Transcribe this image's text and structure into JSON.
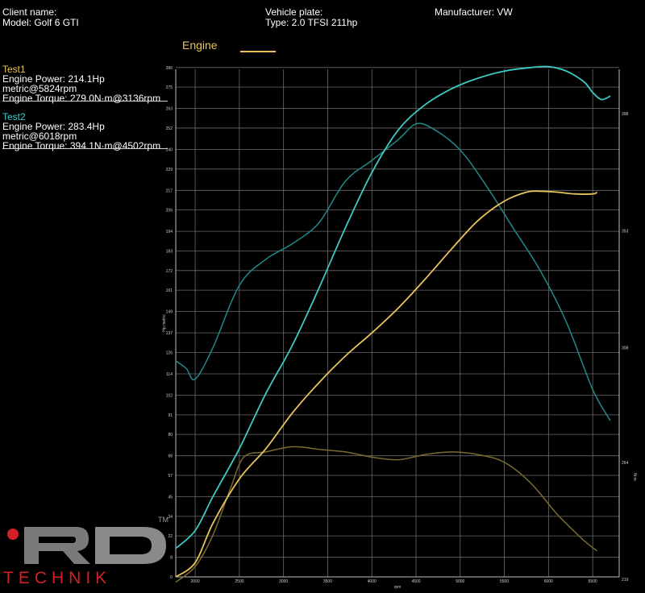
{
  "header": {
    "client_label": "Client name:",
    "model": "Model: Golf 6 GTI",
    "plate_label": "Vehicle plate:",
    "type": "Type: 2.0 TFSI 211hp",
    "manufacturer": "Manufacturer: VW"
  },
  "legend": {
    "title": "Engine",
    "tests": [
      {
        "name": "Test1",
        "power": "Engine Power: 214.1Hp metric@5824rpm",
        "torque": "Engine Torque: 279.0N·m@3136rpm"
      },
      {
        "name": "Test2",
        "power": "Engine Power: 283.4Hp metric@6018rpm",
        "torque": "Engine Torque: 394.1N·m@4502rpm"
      }
    ]
  },
  "brand": {
    "name": "TECHNIK",
    "tm": "TM"
  },
  "colors": {
    "test1": "#e8c45a",
    "test2": "#3ec9c4",
    "torque1": "#7a6a2e",
    "torque2": "#1f8a86",
    "grid": "#6a6a6a"
  },
  "chart_data": {
    "type": "line",
    "xlabel": "rpm",
    "ylabel": "Hp metric",
    "y2label": "N·m",
    "xlim": [
      1780,
      6800
    ],
    "ylim": [
      0,
      285
    ],
    "y2lim": [
      220,
      415
    ],
    "x_ticks": [
      2000,
      2500,
      3000,
      3500,
      4000,
      4500,
      5000,
      5500,
      6000,
      6500
    ],
    "y_ticks": [
      0,
      11,
      23,
      34,
      45,
      57,
      68,
      80,
      91,
      102,
      114,
      126,
      137,
      149,
      161,
      172,
      183,
      194,
      206,
      217,
      229,
      240,
      252,
      263,
      275,
      286
    ],
    "y_tick_labels": [
      "0",
      "8",
      "22",
      "34",
      "45",
      "57",
      "68",
      "80",
      "91",
      "102",
      "114",
      "126",
      "137",
      "149",
      "161",
      "172",
      "183",
      "194",
      "206",
      "217",
      "229",
      "240",
      "252",
      "263",
      "275",
      "286"
    ],
    "y2_ticks": [
      219,
      264,
      308,
      353,
      398
    ],
    "grid": true,
    "series": [
      {
        "name": "Test1",
        "axis": "left",
        "color": "#e8c45a",
        "x": [
          1780,
          2000,
          2200,
          2500,
          2800,
          3100,
          3400,
          3700,
          4000,
          4300,
          4600,
          4900,
          5200,
          5500,
          5750,
          5900,
          6100,
          6300,
          6500,
          6550
        ],
        "y": [
          0,
          8,
          30,
          55,
          72,
          92,
          109,
          124,
          137,
          151,
          167,
          184,
          200,
          211,
          216,
          216.5,
          216,
          215,
          215,
          216
        ]
      },
      {
        "name": "Test2",
        "axis": "left",
        "color": "#3ec9c4",
        "x": [
          1780,
          2000,
          2200,
          2500,
          2800,
          3100,
          3400,
          3700,
          4000,
          4300,
          4600,
          4900,
          5200,
          5500,
          5800,
          6000,
          6200,
          6400,
          6500,
          6600,
          6700
        ],
        "y": [
          16,
          26,
          45,
          72,
          103,
          130,
          162,
          196,
          227,
          251,
          265,
          274,
          280,
          284,
          286,
          286.5,
          284,
          278,
          272,
          268,
          270
        ]
      },
      {
        "name": "Test1 torque",
        "axis": "right",
        "color": "#7a6a2e",
        "x": [
          1780,
          2000,
          2200,
          2400,
          2550,
          2800,
          3100,
          3400,
          3700,
          4000,
          4300,
          4600,
          4900,
          5200,
          5500,
          5800,
          6100,
          6400,
          6550
        ],
        "y": [
          218,
          224,
          236,
          254,
          266,
          268,
          270,
          269,
          268,
          266,
          265,
          267,
          268,
          267,
          264,
          256,
          244,
          234,
          230
        ]
      },
      {
        "name": "Test2 torque",
        "axis": "right",
        "color": "#1f8a86",
        "x": [
          1780,
          1900,
          2000,
          2200,
          2500,
          2800,
          3100,
          3400,
          3700,
          4000,
          4300,
          4500,
          4700,
          5000,
          5300,
          5600,
          5900,
          6200,
          6500,
          6700
        ],
        "y": [
          303,
          300,
          296,
          308,
          332,
          342,
          348,
          356,
          372,
          380,
          388,
          394,
          392,
          384,
          370,
          354,
          338,
          318,
          292,
          280
        ]
      }
    ]
  }
}
